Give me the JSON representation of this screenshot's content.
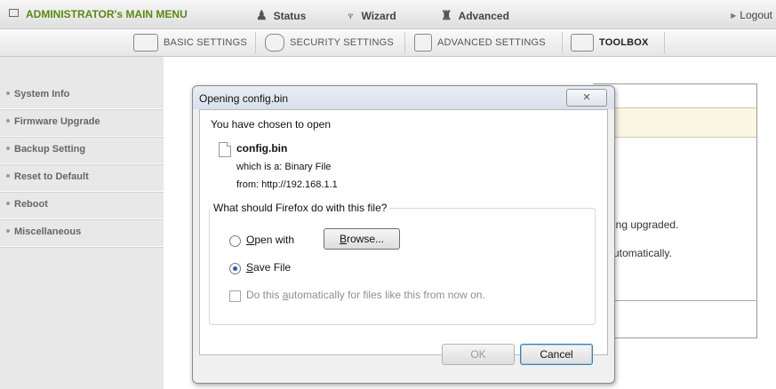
{
  "topbar": {
    "admin_menu": "ADMINISTRATOR's MAIN MENU",
    "status": "Status",
    "wizard": "Wizard",
    "advanced": "Advanced",
    "logout": "Logout"
  },
  "tabs": [
    {
      "label": "BASIC SETTINGS",
      "icon": "basic-settings-icon"
    },
    {
      "label": "SECURITY SETTINGS",
      "icon": "security-settings-icon"
    },
    {
      "label": "ADVANCED SETTINGS",
      "icon": "advanced-settings-icon"
    },
    {
      "label": "TOOLBOX",
      "icon": "toolbox-icon",
      "active": true
    }
  ],
  "sidebar": {
    "items": [
      {
        "label": "System Info"
      },
      {
        "label": "Firmware Upgrade"
      },
      {
        "label": "Backup Setting"
      },
      {
        "label": "Reset to Default"
      },
      {
        "label": "Reboot"
      },
      {
        "label": "Miscellaneous"
      }
    ]
  },
  "main": {
    "partial_line1": "ing upgraded.",
    "partial_line2": "utomatically."
  },
  "dialog": {
    "title": "Opening config.bin",
    "close": "✕",
    "intro": "You have chosen to open",
    "filename": "config.bin",
    "which_is_label": "which is a:",
    "which_is_value": "Binary File",
    "from_label": "from:",
    "from_value": "http://192.168.1.1",
    "question": "What should Firefox do with this file?",
    "open_with_prefix": "O",
    "open_with_rest": "pen with",
    "browse_prefix": "B",
    "browse_rest": "rowse...",
    "save_prefix": "S",
    "save_rest": "ave File",
    "auto_pre": "Do this ",
    "auto_key": "a",
    "auto_post": "utomatically for files like this from now on.",
    "ok": "OK",
    "cancel": "Cancel"
  },
  "colors": {
    "accent_green": "#5a8a12",
    "dialog_focus": "#3c7fb1"
  }
}
